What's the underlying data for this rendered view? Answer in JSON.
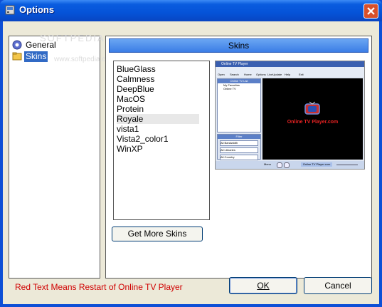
{
  "window": {
    "title": "Options"
  },
  "tree": {
    "items": [
      {
        "label": "General",
        "icon": "gear-icon"
      },
      {
        "label": "Skins",
        "icon": "folder-icon",
        "selected": true
      }
    ]
  },
  "panel": {
    "header": "Skins",
    "skins": [
      "BlueGlass",
      "Calmness",
      "DeepBlue",
      "MacOS",
      "Protein",
      "Royale",
      "vista1",
      "Vista2_color1",
      "WinXP"
    ],
    "highlighted_skin": "Royale",
    "get_more_label": "Get More Skins",
    "preview": {
      "app_title": "Online TV Player",
      "toolbar": [
        "Open",
        "Search",
        "Home",
        "Options",
        "LiveUpdate",
        "Help",
        "Exit"
      ],
      "tree_header": "Online TV List",
      "tree_items": [
        "My Favorites",
        "Online TV"
      ],
      "filter_header": "Filter",
      "filters": [
        "All Bandwidth",
        "All Libraries",
        "All Country"
      ],
      "brand_text": "Online TV Player.com",
      "status_left": "Menu",
      "status_link": "Online TV Player.com"
    }
  },
  "footer": {
    "note": "Red Text Means Restart of Online TV Player",
    "ok_label": "OK",
    "cancel_label": "Cancel"
  },
  "watermark": {
    "logo": "SOFTPEDIA",
    "url": "www.softpedia.com"
  },
  "colors": {
    "title_blue": "#0553d8",
    "selection": "#316ac5",
    "note_red": "#d00000",
    "close_red": "#d8502a"
  }
}
